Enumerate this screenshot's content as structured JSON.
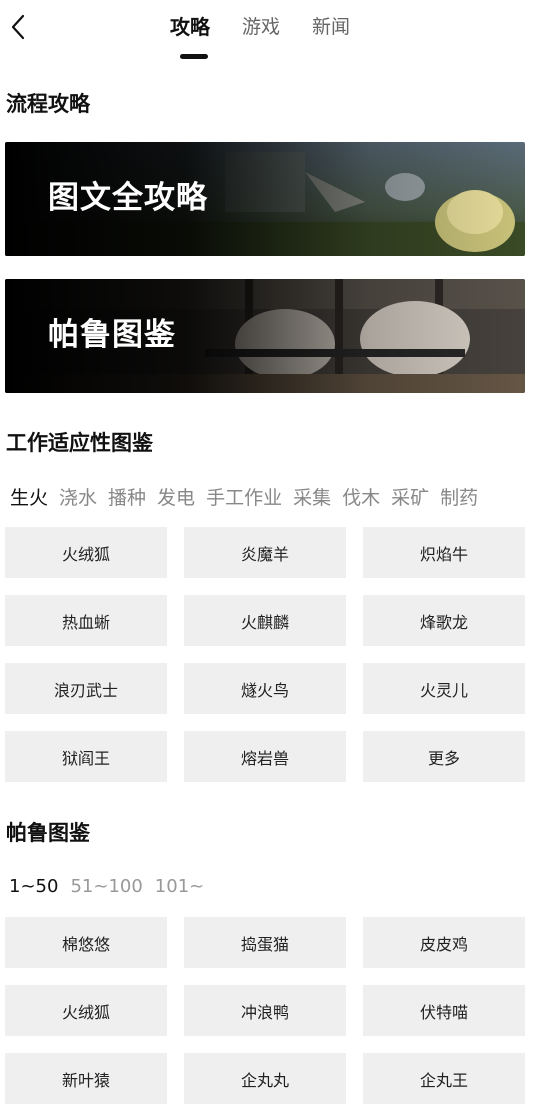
{
  "nav": {
    "tabs": [
      {
        "label": "攻略",
        "active": true
      },
      {
        "label": "游戏",
        "active": false
      },
      {
        "label": "新闻",
        "active": false
      }
    ]
  },
  "process_section": {
    "title": "流程攻略",
    "banners": [
      {
        "label": "图文全攻略"
      },
      {
        "label": "帕鲁图鉴"
      }
    ]
  },
  "work_section": {
    "title": "工作适应性图鉴",
    "categories": [
      "生火",
      "浇水",
      "播种",
      "发电",
      "手工作业",
      "采集",
      "伐木",
      "采矿",
      "制药"
    ],
    "active_category": "生火",
    "items": [
      "火绒狐",
      "炎魔羊",
      "炽焰牛",
      "热血蜥",
      "火麒麟",
      "烽歌龙",
      "浪刃武士",
      "燧火鸟",
      "火灵儿",
      "狱阎王",
      "熔岩兽",
      "更多"
    ]
  },
  "pal_section": {
    "title": "帕鲁图鉴",
    "ranges": [
      "1~50",
      "51~100",
      "101~"
    ],
    "active_range": "1~50",
    "items": [
      "棉悠悠",
      "捣蛋猫",
      "皮皮鸡",
      "火绒狐",
      "冲浪鸭",
      "伏特喵",
      "新叶猿",
      "企丸丸",
      "企丸王"
    ]
  }
}
